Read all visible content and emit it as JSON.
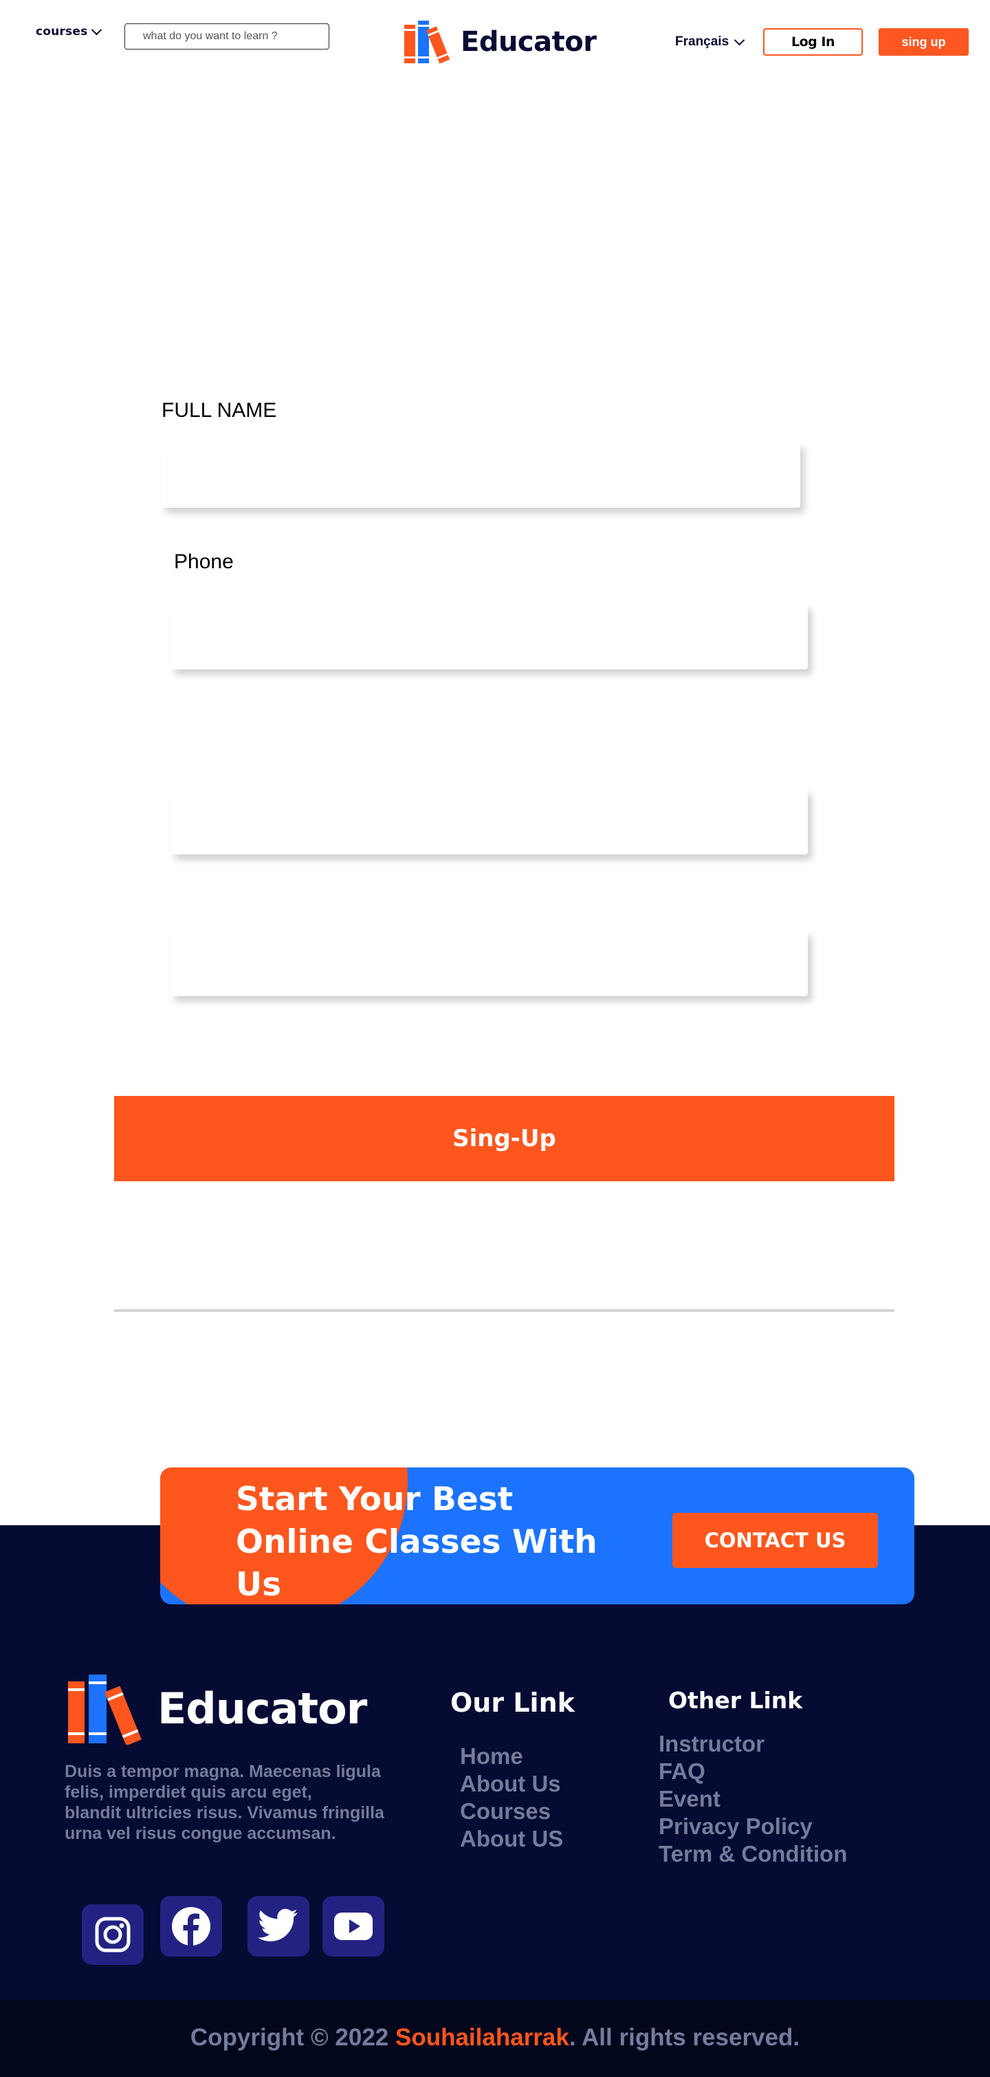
{
  "header": {
    "courses_label": "courses",
    "search_placeholder": "what do you want to learn ?",
    "brand_name": "Educator",
    "language": "Français",
    "login_label": "Log In",
    "signup_label": "sing up"
  },
  "form": {
    "full_name_label": "FULL NAME",
    "phone_label": "Phone",
    "submit_label": "Sing-Up"
  },
  "cta": {
    "title": "Start Your Best Online Classes With Us",
    "button_label": "CONTACT US"
  },
  "footer": {
    "brand_name": "Educator",
    "description": "Duis a tempor magna. Maecenas ligula felis, imperdiet quis arcu eget,\n blandit ultricies risus. Vivamus fringilla urna vel risus congue accumsan.",
    "our_link_title": "Our Link",
    "our_links": [
      "Home",
      "About Us",
      "Courses",
      "About US"
    ],
    "other_link_title": "Other Link",
    "other_links": [
      "Instructor",
      "FAQ",
      "Event",
      "Privacy Policy",
      "Term & Condition"
    ],
    "social_icons": [
      "instagram-icon",
      "facebook-icon",
      "twitter-icon",
      "youtube-icon"
    ],
    "copyright_prefix": "Copyright © 2022 ",
    "copyright_author": "Souhailaharrak",
    "copyright_suffix": ". All rights reserved."
  },
  "colors": {
    "accent_orange": "#ff561e",
    "accent_blue": "#1c73ff",
    "footer_bg": "#050b32",
    "muted_text": "#757b9b"
  }
}
